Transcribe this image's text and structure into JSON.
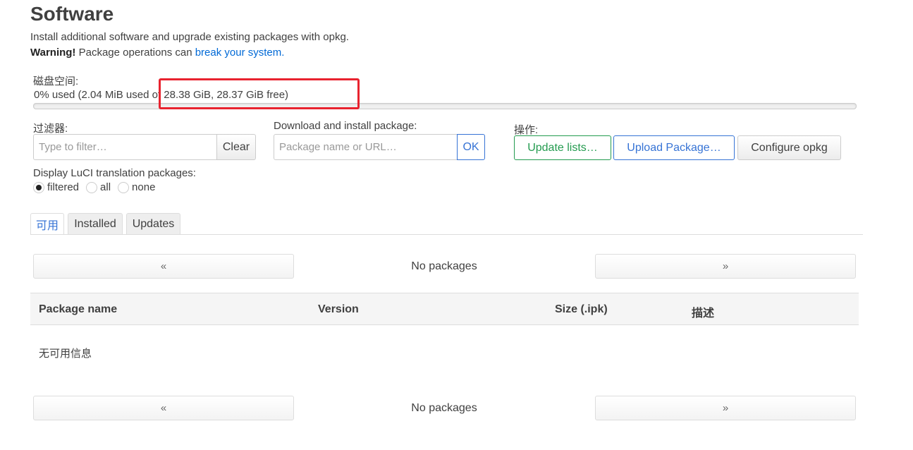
{
  "page": {
    "title": "Software",
    "description": "Install additional software and upgrade existing packages with opkg.",
    "warning_bold": "Warning!",
    "warning_text": " Package operations can ",
    "warning_link": "break your system."
  },
  "disk": {
    "label": "磁盘空间:",
    "usage_text": "0% used (2.04 MiB used of 28.38 GiB, 28.37 GiB free)",
    "used_fraction": 0
  },
  "filter": {
    "label": "过滤器:",
    "placeholder": "Type to filter…",
    "clear_label": "Clear"
  },
  "download": {
    "label": "Download and install package:",
    "placeholder": "Package name or URL…",
    "ok_label": "OK"
  },
  "actions": {
    "label": "操作:",
    "update_lists": "Update lists…",
    "upload_package": "Upload Package…",
    "configure": "Configure opkg"
  },
  "translation": {
    "label": "Display LuCI translation packages:",
    "options": [
      "filtered",
      "all",
      "none"
    ],
    "selected": "filtered"
  },
  "tabs": [
    "可用",
    "Installed",
    "Updates"
  ],
  "pager": {
    "prev": "«",
    "next": "»",
    "status": "No packages"
  },
  "table": {
    "columns": [
      "Package name",
      "Version",
      "Size (.ipk)",
      "描述"
    ],
    "empty_text": "无可用信息"
  },
  "colors": {
    "accent_blue": "#3673d5",
    "accent_green": "#239b4f",
    "highlight_red": "#e8232f"
  }
}
